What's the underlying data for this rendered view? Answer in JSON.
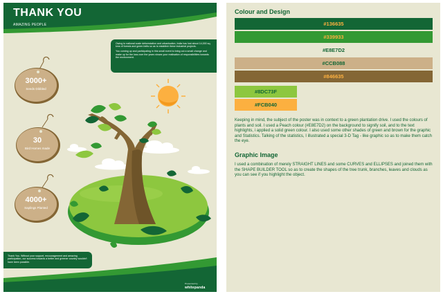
{
  "poster": {
    "title": "THANK YOU",
    "subtitle": "AMAZING PEOPLE",
    "info_paragraph_1": "Owing to national scale deforestation and urbanisation, India has lost about 14,000 sq. kms of forests and green belts so as to establish these industrial projects.",
    "info_paragraph_2": "You coming up and participating in this small event to bring out a small change and make up for the loss over the years shows your realisation of responsibilities towards the environment.",
    "tags": [
      {
        "number": "3000+",
        "label": "Seeds Dibbled"
      },
      {
        "number": "30",
        "label": "Bird Homes made"
      },
      {
        "number": "4000+",
        "label": "Saplings Planted"
      }
    ],
    "thanks_text": "Thank You. Without your support, encouragement and amazing participation, our success towards a better and greener country wouldn't have been possible.",
    "credit_prefix": "Presented by",
    "credit_name": "whitepanda"
  },
  "panel": {
    "colour_heading": "Colour and Design",
    "swatches": [
      {
        "label": "#136635",
        "bg": "#136635",
        "fg": "#FCB040"
      },
      {
        "label": "#339933",
        "bg": "#339933",
        "fg": "#FCB040"
      },
      {
        "label": "#E8E7D2",
        "bg": "#E8E7D2",
        "fg": "#136635"
      },
      {
        "label": "#CCB088",
        "bg": "#CCB088",
        "fg": "#136635"
      },
      {
        "label": "#846635",
        "bg": "#846635",
        "fg": "#FCB040"
      },
      {
        "label": "#8DC73F",
        "bg": "#8DC73F",
        "fg": "#136635"
      },
      {
        "label": "#FCB040",
        "bg": "#FCB040",
        "fg": "#136635"
      }
    ],
    "colour_text": "Keeping in mind, the subject of the poster was in context to a green plantation drive. I used the colours of plants and soil. I used a Peach colour (#E8E7D2) on the background to signify soil, and to the text highlights, i applied a solid green colour. I also used some other shades of green and brown for the graphic and Statistics. Talking of the statistics, I illustrated a special 3-D Tag - like graphic so as to make them catch the eye.",
    "graphic_heading": "Graphic Image",
    "graphic_text": "I used a combination of merely STRAIGHT LINES and some CURVES and ELLIPSES and joined them with the SHAPE BUILDER TOOL so as to create the shapes of the tree trunk, branches, leaves and clouds as you can see if you highlight the object."
  }
}
